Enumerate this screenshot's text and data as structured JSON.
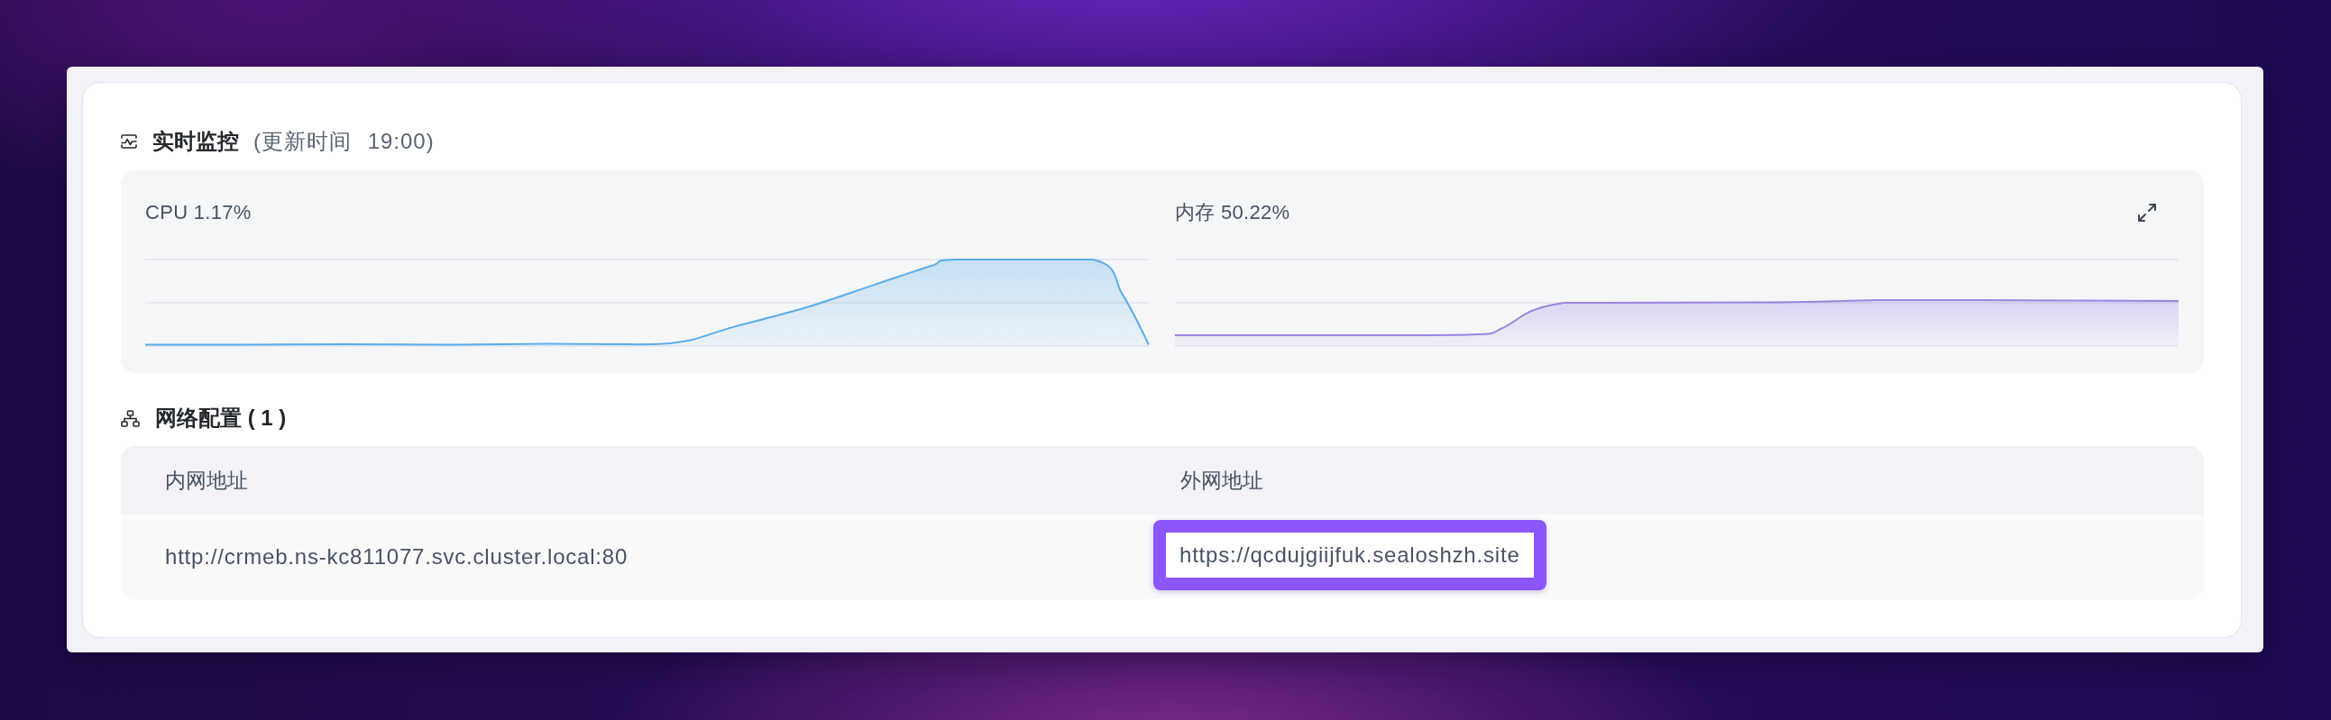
{
  "monitor": {
    "title": "实时监控",
    "updated": "(更新时间 19:00)",
    "expandable": true,
    "charts": [
      {
        "label": "CPU 1.17%",
        "color": "#5aaeea"
      },
      {
        "label": "内存 50.22%",
        "color": "#9a86e2"
      }
    ]
  },
  "network": {
    "title": "网络配置 ( 1 )",
    "columns": [
      "内网地址",
      "外网地址"
    ],
    "rows": [
      {
        "cells": [
          {
            "text": "http://crmeb.ns-kc811077.svc.cluster.local:80",
            "highlighted": false
          },
          {
            "text": "https://qcdujgiijfuk.sealoshzh.site",
            "highlighted": true
          }
        ]
      }
    ]
  }
}
